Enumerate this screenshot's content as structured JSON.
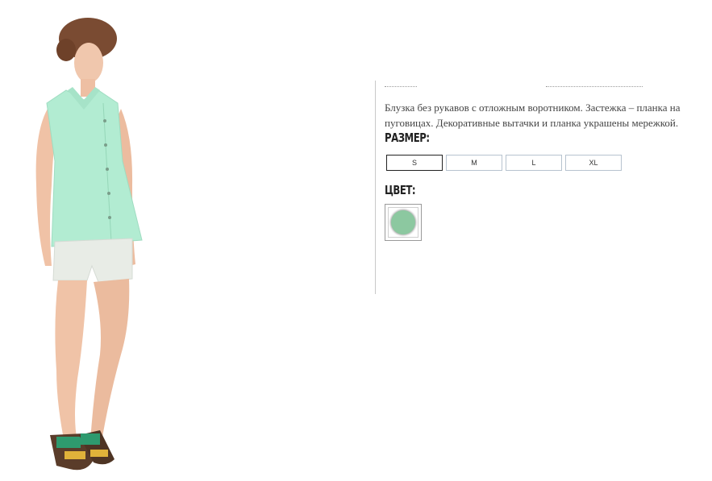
{
  "product": {
    "description": "Блузка без рукавов с отложным воротником. Застежка – планка на пуговицах. Декоративные вытачки и планка украшены мережкой.",
    "photo_alt": "Модель в мятной блузке без рукавов и шортах"
  },
  "size": {
    "label": "РАЗМЕР:",
    "options": [
      "S",
      "M",
      "L",
      "XL"
    ],
    "selected": "S"
  },
  "color": {
    "label": "ЦВЕТ:",
    "swatch_hex": "#8cc8a0",
    "swatch_name": "mint"
  },
  "colors": {
    "blouse": "#b2ecd2",
    "text": "#444444",
    "divider": "#c8c8c8"
  }
}
